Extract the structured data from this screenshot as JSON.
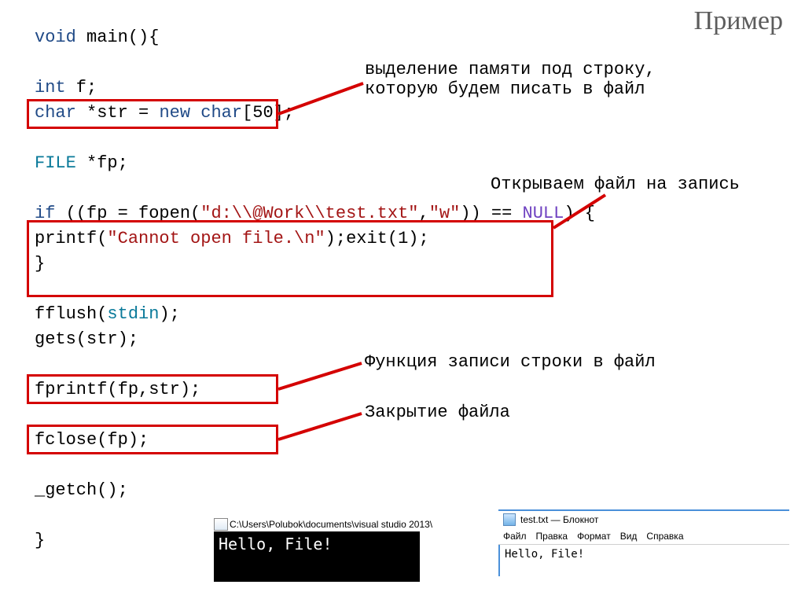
{
  "title": "Пример",
  "code": {
    "l1_void": "void",
    "l1_rest": " main(){",
    "l3_int": "int",
    "l3_rest": " f;",
    "l4_char": "char",
    "l4_mid": " *str = ",
    "l4_new": "new",
    "l4_char2": " char",
    "l4_end": "[50];",
    "l6_file": "FILE",
    "l6_rest": " *fp;",
    "l8_if": "if",
    "l8_a": " ((fp = fopen(",
    "l8_s1": "\"d:\\\\@Work\\\\test.txt\"",
    "l8_b": ",",
    "l8_s2": "\"w\"",
    "l8_c": ")) == ",
    "l8_null": "NULL",
    "l8_d": ") {",
    "l9_a": "printf(",
    "l9_s": "\"Cannot open file.\\n\"",
    "l9_b": ");exit(1);",
    "l10": "}",
    "l12_a": "fflush(",
    "l12_stdin": "stdin",
    "l12_b": ");",
    "l13": "gets(str);",
    "l15": "fprintf(fp,str);",
    "l17": "fclose(fp);",
    "l19": "_getch();",
    "l21": "}"
  },
  "annotations": {
    "a1": "выделение памяти под строку,\nкоторую будем писать в файл",
    "a2": "Открываем файл на запись",
    "a3": "Функция записи строки в файл",
    "a4": "Закрытие файла"
  },
  "console": {
    "title_path": "C:\\Users\\Polubok\\documents\\visual studio 2013\\",
    "text": "Hello, File!"
  },
  "notepad": {
    "title": "test.txt — Блокнот",
    "menu": [
      "Файл",
      "Правка",
      "Формат",
      "Вид",
      "Справка"
    ],
    "content": "Hello, File!"
  }
}
